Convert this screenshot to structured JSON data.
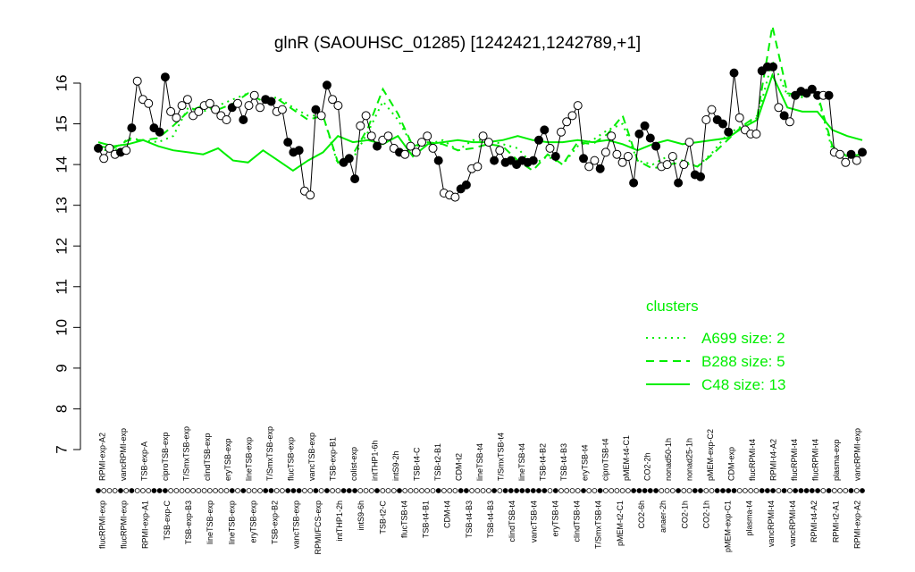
{
  "chart_data": {
    "type": "line",
    "title": "glnR (SAOUHSC_01285) [1242421,1242789,+1]",
    "xlabel": "",
    "ylabel": "",
    "ylim": [
      7,
      16.5
    ],
    "yticks": [
      7,
      8,
      9,
      10,
      11,
      12,
      13,
      14,
      15,
      16
    ],
    "grid": false,
    "legend_position": "right",
    "legend_title": "clusters",
    "categories_top": [
      "RPMI-exp-A2",
      "vancRPMI-exp",
      "TSB-exp-A",
      "ciproTSB-exp",
      "T/SmxTSB-exp",
      "clindTSB-exp",
      "eryTSB-exp",
      "lineTSB-exp",
      "T/SmxTSB-exp",
      "flucTSB-exp",
      "vancTSB-exp",
      "TSB-exp-B1",
      "colist-exp",
      "intTHP1-6h",
      "intS9-2h",
      "TSB-t4-C",
      "TSB-t2-B1",
      "CDM-t2",
      "lineTSB-t4",
      "T/SmxTSB-t4",
      "lineTSB-t4",
      "TSB-t4-B2",
      "TSB-t4-B3",
      "eryTSB-t4",
      "ciproTSB-t4",
      "pMEM-t4-C1",
      "CO2-2h",
      "nonad50-1h",
      "nonad25-1h",
      "pMEM-exp-C2",
      "CDM-exp",
      "flucRPMI-t4",
      "RPMI-t4-A2",
      "flucRPMI-t4",
      "flucRPMI-t4",
      "plasma-exp",
      "vancRPMI-exp"
    ],
    "categories_bottom": [
      "flucRPMI-exp",
      "flucRPMI-exp",
      "RPMI-exp-A1",
      "TSB-exp-C",
      "TSB-exp-B3",
      "lineTSB-exp",
      "lineTSB-exp",
      "eryTSB-exp",
      "TSB-exp-B2",
      "vancTSB-exp",
      "RPMI/FCS-exp",
      "intTHP1-2h",
      "intS9-6h",
      "TSB-t2-C",
      "flucTSB-t4",
      "TSB-t4-B1",
      "CDM-t4",
      "TSB-t4-B3",
      "TSB-t4-B3",
      "clindTSB-t4",
      "vancTSB-t4",
      "eryTSB-t4",
      "clindTSB-t4",
      "T/SmxTSB-t4",
      "pMEM-t2-C1",
      "CO2-6h",
      "anaer-2h",
      "CO2-1h",
      "CO2-1h",
      "pMEM-exp-C1",
      "plasma-t4",
      "vancRPMI-t4",
      "vancRPMI-t4",
      "RPMI-t4-A2",
      "RPMI-t2-A1",
      "RPMI-exp-A2"
    ],
    "values": [
      14.4,
      14.15,
      14.4,
      14.25,
      14.3,
      14.35,
      14.9,
      16.05,
      15.6,
      15.5,
      14.9,
      14.8,
      16.15,
      15.3,
      15.15,
      15.45,
      15.6,
      15.2,
      15.3,
      15.45,
      15.5,
      15.35,
      15.2,
      15.1,
      15.4,
      15.5,
      15.1,
      15.45,
      15.7,
      15.4,
      15.6,
      15.55,
      15.3,
      15.35,
      14.55,
      14.3,
      14.35,
      13.35,
      13.25,
      15.35,
      15.2,
      15.95,
      15.6,
      15.45,
      14.05,
      14.15,
      13.65,
      14.95,
      15.2,
      14.7,
      14.45,
      14.6,
      14.7,
      14.4,
      14.3,
      14.25,
      14.45,
      14.3,
      14.55,
      14.7,
      14.4,
      14.1,
      13.3,
      13.25,
      13.2,
      13.4,
      13.5,
      13.9,
      13.95,
      14.7,
      14.55,
      14.1,
      14.35,
      14.05,
      14.1,
      14.0,
      14.1,
      14.05,
      14.1,
      14.6,
      14.85,
      14.4,
      14.2,
      14.8,
      15.05,
      15.2,
      15.45,
      14.15,
      13.95,
      14.1,
      13.9,
      14.3,
      14.7,
      14.25,
      14.05,
      14.2,
      13.55,
      14.75,
      14.95,
      14.65,
      14.45,
      13.95,
      14.0,
      14.2,
      13.55,
      14.0,
      14.55,
      13.75,
      13.7,
      15.1,
      15.35,
      15.1,
      15.0,
      14.8,
      16.25,
      15.15,
      14.85,
      14.75,
      14.75,
      16.3,
      16.4,
      16.4,
      15.4,
      15.2,
      15.05,
      15.7,
      15.8,
      15.75,
      15.85,
      15.7,
      15.7,
      15.7,
      14.3,
      14.25,
      14.05,
      14.25,
      14.1,
      14.3
    ],
    "marker_open": [
      0,
      1,
      1,
      1,
      0,
      1,
      0,
      1,
      1,
      1,
      0,
      0,
      0,
      1,
      1,
      1,
      1,
      1,
      1,
      1,
      1,
      1,
      1,
      1,
      0,
      1,
      0,
      1,
      1,
      1,
      0,
      0,
      1,
      1,
      0,
      0,
      0,
      1,
      1,
      0,
      1,
      0,
      1,
      1,
      0,
      0,
      0,
      1,
      1,
      1,
      0,
      1,
      1,
      1,
      0,
      1,
      1,
      1,
      1,
      1,
      1,
      0,
      1,
      1,
      1,
      0,
      0,
      1,
      1,
      1,
      1,
      0,
      1,
      0,
      0,
      0,
      0,
      0,
      0,
      0,
      0,
      1,
      0,
      1,
      1,
      1,
      1,
      0,
      1,
      1,
      0,
      1,
      1,
      1,
      1,
      1,
      0,
      0,
      0,
      0,
      0,
      1,
      1,
      1,
      0,
      1,
      1,
      0,
      0,
      1,
      1,
      0,
      0,
      0,
      0,
      1,
      1,
      1,
      1,
      0,
      0,
      0,
      1,
      0,
      1,
      0,
      0,
      0,
      0,
      0,
      1,
      0,
      1,
      1,
      1,
      0,
      1
    ],
    "series": [
      {
        "name": "A699 size: 2",
        "style": "dotted",
        "color": "#00ee00",
        "values": [
          14.4,
          14.3,
          14.65,
          14.6,
          14.55,
          14.7,
          15.4,
          15.3,
          15.45,
          15.6,
          15.75,
          15.6,
          15.65,
          15.4,
          15.2,
          15.2,
          14.0,
          14.15,
          14.8,
          15.55,
          15.1,
          14.45,
          14.5,
          14.6,
          14.35,
          14.6,
          14.6,
          14.5,
          14.4,
          14.0,
          14.2,
          14.0,
          14.45,
          14.6,
          14.85,
          15.0,
          14.1,
          14.0,
          14.2,
          14.1,
          13.95,
          14.3,
          14.75,
          14.95,
          15.15,
          16.55,
          15.7,
          15.65,
          15.7,
          14.35,
          14.2,
          14.25
        ]
      },
      {
        "name": "B288 size: 5",
        "style": "dashed",
        "color": "#00ee00",
        "values": [
          14.45,
          14.4,
          14.6,
          14.6,
          14.65,
          14.95,
          15.3,
          15.45,
          15.35,
          15.5,
          15.75,
          15.55,
          15.6,
          15.35,
          15.1,
          15.2,
          14.05,
          14.25,
          14.9,
          15.85,
          15.25,
          14.45,
          14.55,
          14.5,
          14.35,
          14.4,
          14.5,
          14.45,
          14.1,
          13.85,
          14.25,
          14.0,
          14.55,
          14.5,
          14.75,
          15.2,
          14.1,
          13.9,
          14.0,
          14.05,
          13.95,
          14.25,
          14.6,
          14.95,
          15.2,
          17.4,
          15.75,
          15.7,
          15.75,
          14.45,
          14.2,
          14.25
        ]
      },
      {
        "name": "C48 size: 13",
        "style": "solid",
        "color": "#00ee00",
        "values": [
          14.55,
          14.45,
          14.5,
          14.6,
          14.45,
          14.35,
          14.3,
          14.25,
          14.4,
          14.1,
          14.05,
          14.35,
          14.1,
          13.85,
          14.1,
          14.3,
          14.7,
          14.55,
          14.6,
          14.5,
          14.7,
          14.2,
          14.5,
          14.55,
          14.6,
          14.55,
          14.55,
          14.6,
          14.7,
          14.6,
          14.55,
          14.55,
          14.6,
          14.55,
          14.6,
          14.5,
          14.35,
          14.5,
          14.6,
          14.5,
          14.55,
          14.6,
          14.65,
          14.9,
          15.1,
          16.2,
          15.4,
          15.3,
          15.3,
          14.85,
          14.7,
          14.6
        ]
      }
    ],
    "legend": [
      {
        "label": "A699 size: 2",
        "style": "dotted"
      },
      {
        "label": "B288 size: 5",
        "style": "dashed"
      },
      {
        "label": "C48 size: 13",
        "style": "solid"
      }
    ]
  },
  "colors": {
    "points": "#000000",
    "cluster_lines": "#00ee00",
    "background": "#ffffff"
  }
}
